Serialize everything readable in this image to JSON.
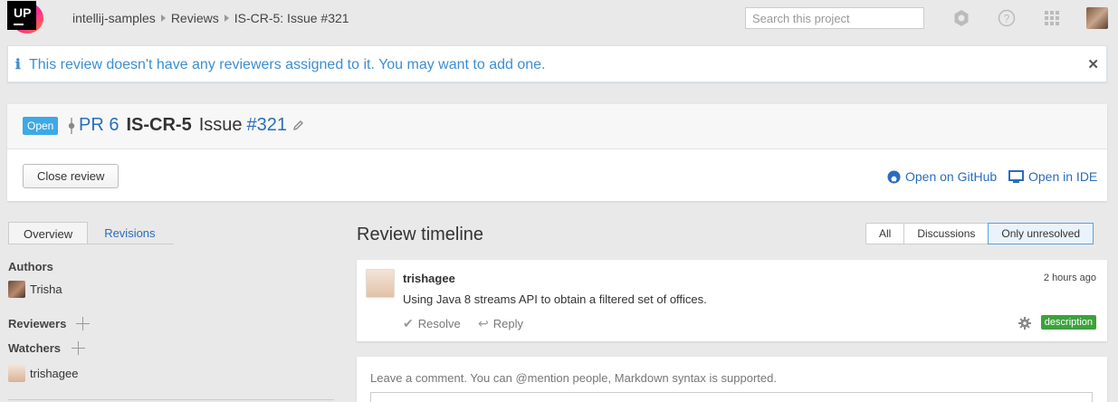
{
  "logo": {
    "text": "UP"
  },
  "breadcrumb": [
    "intellij-samples",
    "Reviews",
    "IS-CR-5: Issue #321"
  ],
  "search": {
    "placeholder": "Search this project",
    "value": ""
  },
  "topbar_icons": [
    "settings-icon",
    "help-icon",
    "apps-grid-icon",
    "user-avatar"
  ],
  "alert": {
    "icon": "info-icon",
    "message": "This review doesn't have any reviewers assigned to it. You may want to add one.",
    "close_icon": "close-icon"
  },
  "review": {
    "status_badge": "Open",
    "pr_label": "PR 6",
    "code": "IS-CR-5",
    "issue_label": "Issue",
    "issue_number": "#321",
    "close_button": "Close review",
    "open_github": "Open on GitHub",
    "open_ide": "Open in IDE"
  },
  "tabs": {
    "overview": "Overview",
    "revisions": "Revisions"
  },
  "sidebar": {
    "authors_label": "Authors",
    "author_name": "Trisha",
    "reviewers_label": "Reviewers",
    "watchers_label": "Watchers",
    "watcher_name": "trishagee"
  },
  "timeline": {
    "title": "Review timeline",
    "filters": [
      "All",
      "Discussions",
      "Only unresolved"
    ],
    "active_filter": "Only unresolved"
  },
  "comment": {
    "author": "trishagee",
    "time": "2 hours ago",
    "text": "Using Java 8 streams API to obtain a filtered set of offices.",
    "resolve": "Resolve",
    "reply": "Reply",
    "badge": "description"
  },
  "new_comment": {
    "hint": "Leave a comment. You can @mention people, Markdown syntax is supported."
  },
  "colors": {
    "link": "#2a6dbd",
    "alert_text": "#3b8ed4",
    "open_badge": "#3da9e6",
    "description_badge": "#3ca23c"
  }
}
